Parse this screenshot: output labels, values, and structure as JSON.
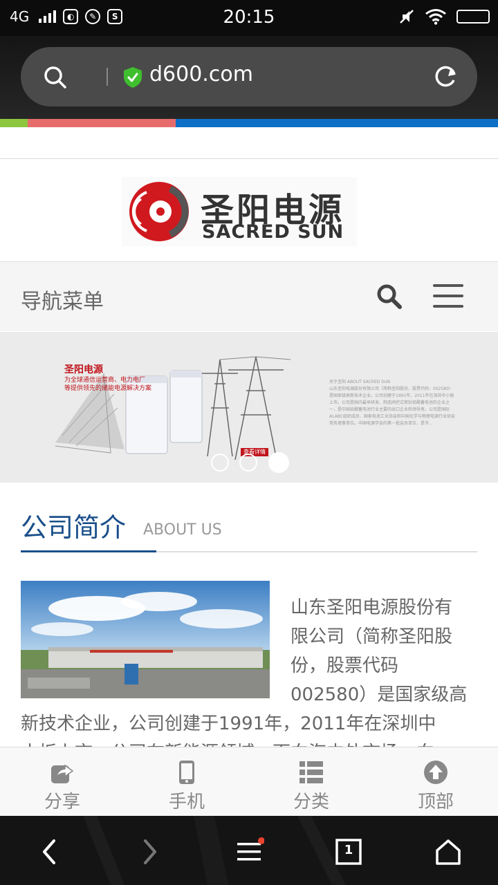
{
  "status_bar": {
    "network": "4G",
    "time": "20:15"
  },
  "browser": {
    "url": "d600.com"
  },
  "colors": {
    "accent_green": "#8dc63f",
    "accent_red": "#e86b6b",
    "accent_blue": "#0d6fc6",
    "section_blue": "#1a4f8a"
  },
  "logo": {
    "cn": "圣阳电源",
    "en": "SACRED SUN"
  },
  "nav": {
    "title": "导航菜单"
  },
  "banner": {
    "brand": "圣阳电源",
    "tagline_1": "为全球通信运营商、电力电厂",
    "tagline_2": "等提供领先的储能电源解决方案",
    "button": "查看详情",
    "about_text": "关于圣阳 ABOUT SACRED SUN\n山东圣阳电源股份有限公司（简称圣阳股份，股票代码：002580）是国家级高新技术企业。公司创建于1991年，2011年在深圳中小板上市。公司是国内最早研发、制造阀控式密封铅酸蓄电池的企业之一，是中国铅酸蓄电池行业主要的出口企业和领导者。公司是国际ALABC组织成员、国家电池工业协会和中国化学与物理电源行业协会常务理事单位。中国电源学会的第一批会员单位，是节…",
    "active_slide": 3,
    "slide_count": 3
  },
  "section": {
    "title_cn": "公司简介",
    "title_en": "ABOUT US"
  },
  "intro": {
    "lines": [
      "山东圣阳电源股份有",
      "限公司（简称圣阳股",
      "份，股票代码",
      "002580）是国家级高",
      "新技术企业，公司创建于1991年，2011年在深圳中",
      "小板上市。公司在新能源领域，面向海内外市场，向"
    ]
  },
  "toolbar": [
    {
      "label": "分享",
      "icon": "share-icon"
    },
    {
      "label": "手机",
      "icon": "mobile-phone-icon"
    },
    {
      "label": "分类",
      "icon": "list-icon"
    },
    {
      "label": "顶部",
      "icon": "arrow-up-circle-icon"
    }
  ],
  "bottom_nav": {
    "tab_count": "1"
  }
}
